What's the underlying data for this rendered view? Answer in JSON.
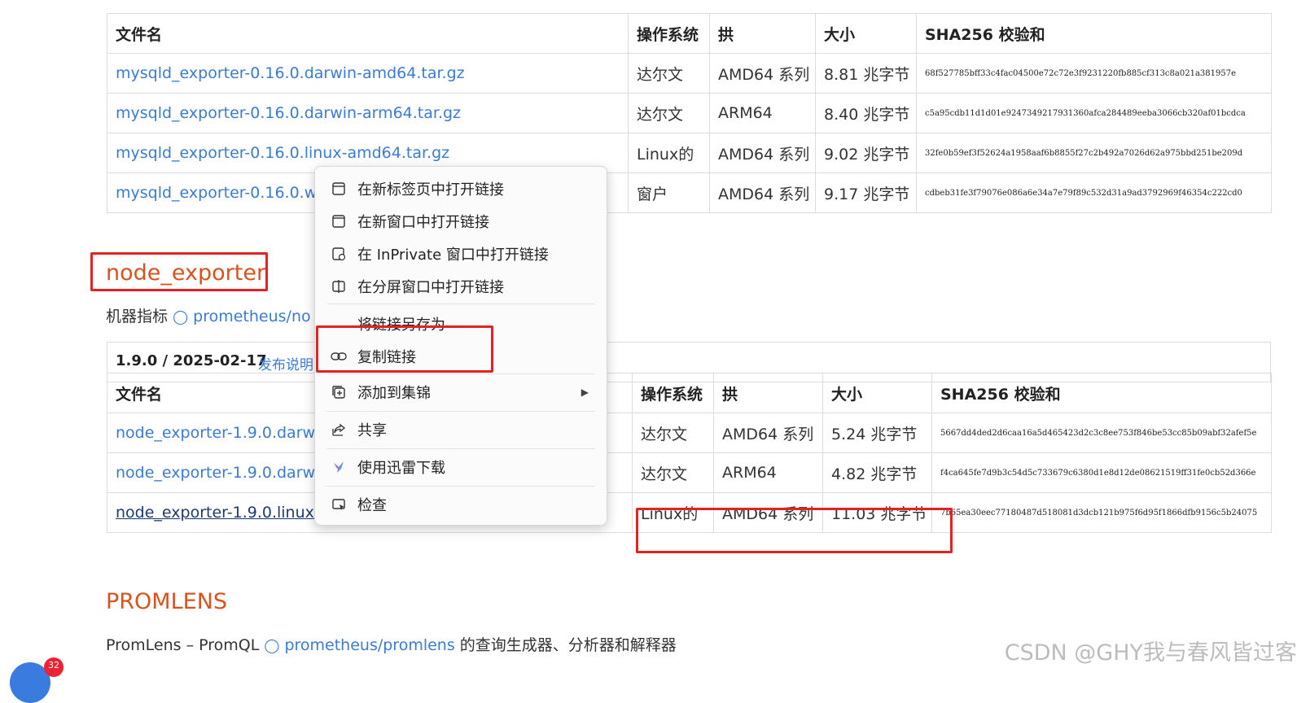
{
  "table1": {
    "headers": [
      "文件名",
      "操作系统",
      "拱",
      "大小",
      "SHA256 校验和"
    ],
    "rows": [
      [
        "mysqld_exporter-0.16.0.darwin-amd64.tar.gz",
        "达尔文",
        "AMD64 系列",
        "8.81 兆字节",
        "68f527785bff33c4fac04500e72c72e3f9231220fb885cf313c8a021a381957e"
      ],
      [
        "mysqld_exporter-0.16.0.darwin-arm64.tar.gz",
        "达尔文",
        "ARM64",
        "8.40 兆字节",
        "c5a95cdb11d1d01e9247349217931360afca284489eeba3066cb320af01bcdca"
      ],
      [
        "mysqld_exporter-0.16.0.linux-amd64.tar.gz",
        "Linux的",
        "AMD64 系列",
        "9.02 兆字节",
        "32fe0b59ef3f52624a1958aaf6b8855f27c2b492a7026d62a975bbd251be209d"
      ],
      [
        "mysqld_exporter-0.16.0.wi",
        "窗户",
        "AMD64 系列",
        "9.17 兆字节",
        "cdbeb31fe3f79076e086a6e34a7e79f89c532d31a9ad3792969f46354c222cd0"
      ]
    ]
  },
  "node_section": {
    "title": "node_exporter",
    "desc_prefix": "机器指标",
    "repo_link": "prometheus/no",
    "version": "1.9.0 / 2025-02-17",
    "release_notes": "发布说明"
  },
  "table2": {
    "headers": [
      "文件名",
      "操作系统",
      "拱",
      "大小",
      "SHA256 校验和"
    ],
    "rows": [
      [
        "node_exporter-1.9.0.darwi",
        "达尔文",
        "AMD64 系列",
        "5.24 兆字节",
        "5667dd4ded2d6caa16a5d465423d2c3c8ee753f846be53cc85b09abf32afef5e"
      ],
      [
        "node_exporter-1.9.0.darwi",
        "达尔文",
        "ARM64",
        "4.82 兆字节",
        "f4ca645fe7d9b3c54d5c733679c6380d1e8d12de08621519ff31fe0cb52d366e"
      ],
      [
        "node_exporter-1.9.0.linux-amd64.tar.gz",
        "Linux的",
        "AMD64 系列",
        "11.03 兆字节",
        "7b65ea30eec77180487d518081d3dcb121b975f6d95f1866dfb9156c5b24075"
      ]
    ]
  },
  "promlens": {
    "title": "PROMLENS",
    "desc_prefix": "PromLens – PromQL",
    "repo_link": "prometheus/promlens",
    "desc_suffix": "的查询生成器、分析器和解释器"
  },
  "context_menu": {
    "items": [
      {
        "label": "在新标签页中打开链接",
        "icon": "new-tab-icon"
      },
      {
        "label": "在新窗口中打开链接",
        "icon": "new-window-icon"
      },
      {
        "label": "在 InPrivate 窗口中打开链接",
        "icon": "inprivate-icon"
      },
      {
        "label": "在分屏窗口中打开链接",
        "icon": "split-screen-icon"
      },
      {
        "label": "将链接另存为",
        "icon": ""
      },
      {
        "label": "复制链接",
        "icon": "link-icon"
      },
      {
        "label": "添加到集锦",
        "icon": "collections-icon"
      },
      {
        "label": "共享",
        "icon": "share-icon"
      },
      {
        "label": "使用迅雷下载",
        "icon": "thunder-icon"
      },
      {
        "label": "检查",
        "icon": "inspect-icon"
      }
    ]
  },
  "badge_count": "32",
  "watermark": "CSDN @GHY我与春风皆过客",
  "colors": {
    "link": "#3a7bd5",
    "section_title": "#d9531e",
    "highlight": "#e52222"
  }
}
